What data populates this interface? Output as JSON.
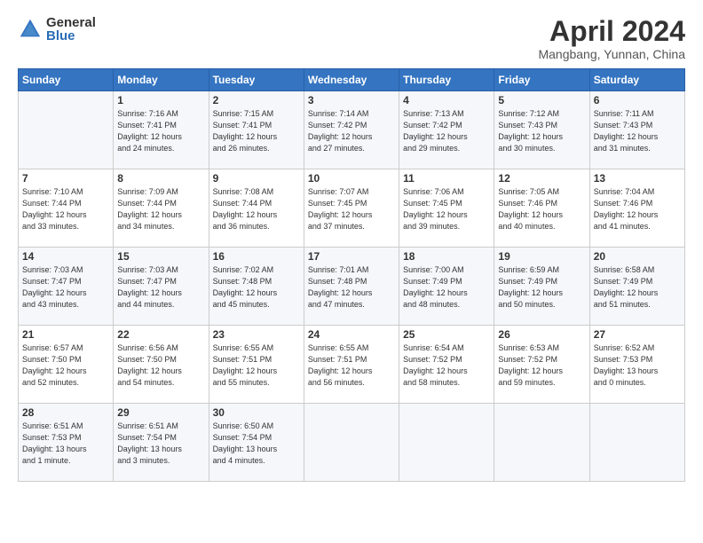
{
  "header": {
    "logo_general": "General",
    "logo_blue": "Blue",
    "title": "April 2024",
    "location": "Mangbang, Yunnan, China"
  },
  "days_of_week": [
    "Sunday",
    "Monday",
    "Tuesday",
    "Wednesday",
    "Thursday",
    "Friday",
    "Saturday"
  ],
  "weeks": [
    [
      {
        "day": "",
        "info": ""
      },
      {
        "day": "1",
        "info": "Sunrise: 7:16 AM\nSunset: 7:41 PM\nDaylight: 12 hours\nand 24 minutes."
      },
      {
        "day": "2",
        "info": "Sunrise: 7:15 AM\nSunset: 7:41 PM\nDaylight: 12 hours\nand 26 minutes."
      },
      {
        "day": "3",
        "info": "Sunrise: 7:14 AM\nSunset: 7:42 PM\nDaylight: 12 hours\nand 27 minutes."
      },
      {
        "day": "4",
        "info": "Sunrise: 7:13 AM\nSunset: 7:42 PM\nDaylight: 12 hours\nand 29 minutes."
      },
      {
        "day": "5",
        "info": "Sunrise: 7:12 AM\nSunset: 7:43 PM\nDaylight: 12 hours\nand 30 minutes."
      },
      {
        "day": "6",
        "info": "Sunrise: 7:11 AM\nSunset: 7:43 PM\nDaylight: 12 hours\nand 31 minutes."
      }
    ],
    [
      {
        "day": "7",
        "info": "Sunrise: 7:10 AM\nSunset: 7:44 PM\nDaylight: 12 hours\nand 33 minutes."
      },
      {
        "day": "8",
        "info": "Sunrise: 7:09 AM\nSunset: 7:44 PM\nDaylight: 12 hours\nand 34 minutes."
      },
      {
        "day": "9",
        "info": "Sunrise: 7:08 AM\nSunset: 7:44 PM\nDaylight: 12 hours\nand 36 minutes."
      },
      {
        "day": "10",
        "info": "Sunrise: 7:07 AM\nSunset: 7:45 PM\nDaylight: 12 hours\nand 37 minutes."
      },
      {
        "day": "11",
        "info": "Sunrise: 7:06 AM\nSunset: 7:45 PM\nDaylight: 12 hours\nand 39 minutes."
      },
      {
        "day": "12",
        "info": "Sunrise: 7:05 AM\nSunset: 7:46 PM\nDaylight: 12 hours\nand 40 minutes."
      },
      {
        "day": "13",
        "info": "Sunrise: 7:04 AM\nSunset: 7:46 PM\nDaylight: 12 hours\nand 41 minutes."
      }
    ],
    [
      {
        "day": "14",
        "info": "Sunrise: 7:03 AM\nSunset: 7:47 PM\nDaylight: 12 hours\nand 43 minutes."
      },
      {
        "day": "15",
        "info": "Sunrise: 7:03 AM\nSunset: 7:47 PM\nDaylight: 12 hours\nand 44 minutes."
      },
      {
        "day": "16",
        "info": "Sunrise: 7:02 AM\nSunset: 7:48 PM\nDaylight: 12 hours\nand 45 minutes."
      },
      {
        "day": "17",
        "info": "Sunrise: 7:01 AM\nSunset: 7:48 PM\nDaylight: 12 hours\nand 47 minutes."
      },
      {
        "day": "18",
        "info": "Sunrise: 7:00 AM\nSunset: 7:49 PM\nDaylight: 12 hours\nand 48 minutes."
      },
      {
        "day": "19",
        "info": "Sunrise: 6:59 AM\nSunset: 7:49 PM\nDaylight: 12 hours\nand 50 minutes."
      },
      {
        "day": "20",
        "info": "Sunrise: 6:58 AM\nSunset: 7:49 PM\nDaylight: 12 hours\nand 51 minutes."
      }
    ],
    [
      {
        "day": "21",
        "info": "Sunrise: 6:57 AM\nSunset: 7:50 PM\nDaylight: 12 hours\nand 52 minutes."
      },
      {
        "day": "22",
        "info": "Sunrise: 6:56 AM\nSunset: 7:50 PM\nDaylight: 12 hours\nand 54 minutes."
      },
      {
        "day": "23",
        "info": "Sunrise: 6:55 AM\nSunset: 7:51 PM\nDaylight: 12 hours\nand 55 minutes."
      },
      {
        "day": "24",
        "info": "Sunrise: 6:55 AM\nSunset: 7:51 PM\nDaylight: 12 hours\nand 56 minutes."
      },
      {
        "day": "25",
        "info": "Sunrise: 6:54 AM\nSunset: 7:52 PM\nDaylight: 12 hours\nand 58 minutes."
      },
      {
        "day": "26",
        "info": "Sunrise: 6:53 AM\nSunset: 7:52 PM\nDaylight: 12 hours\nand 59 minutes."
      },
      {
        "day": "27",
        "info": "Sunrise: 6:52 AM\nSunset: 7:53 PM\nDaylight: 13 hours\nand 0 minutes."
      }
    ],
    [
      {
        "day": "28",
        "info": "Sunrise: 6:51 AM\nSunset: 7:53 PM\nDaylight: 13 hours\nand 1 minute."
      },
      {
        "day": "29",
        "info": "Sunrise: 6:51 AM\nSunset: 7:54 PM\nDaylight: 13 hours\nand 3 minutes."
      },
      {
        "day": "30",
        "info": "Sunrise: 6:50 AM\nSunset: 7:54 PM\nDaylight: 13 hours\nand 4 minutes."
      },
      {
        "day": "",
        "info": ""
      },
      {
        "day": "",
        "info": ""
      },
      {
        "day": "",
        "info": ""
      },
      {
        "day": "",
        "info": ""
      }
    ]
  ]
}
